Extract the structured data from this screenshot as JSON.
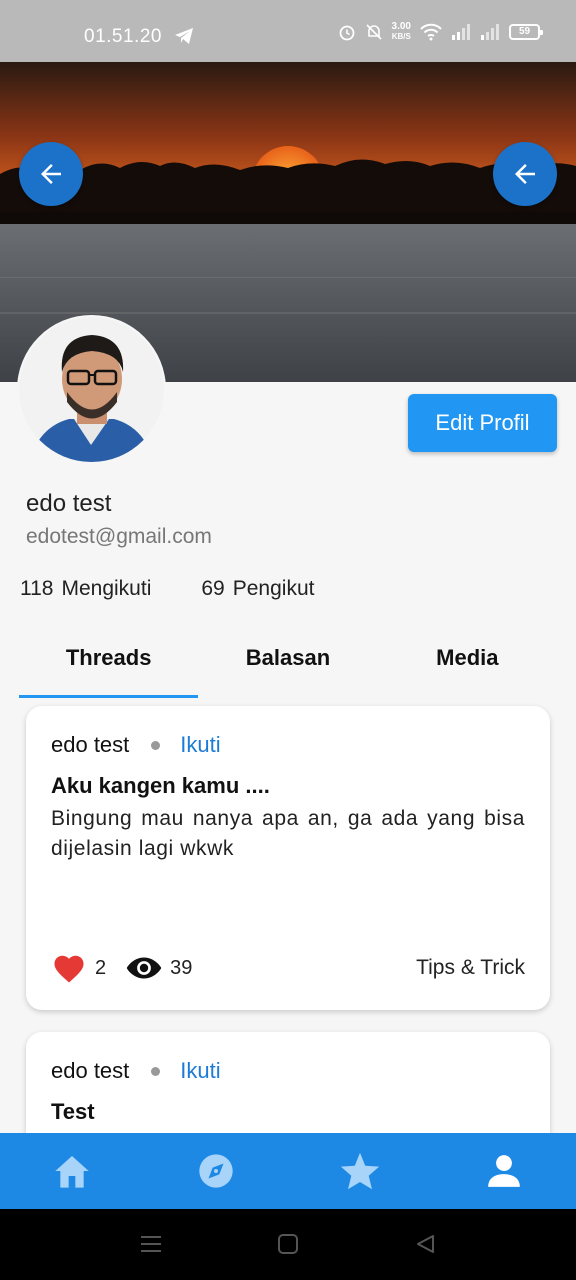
{
  "status_bar": {
    "time": "01.51.20",
    "speed_top": "3.00",
    "speed_unit": "KB/S",
    "battery": "59"
  },
  "profile": {
    "name": "edo test",
    "email": "edotest@gmail.com",
    "following_count": "118",
    "following_label": "Mengikuti",
    "followers_count": "69",
    "followers_label": "Pengikut",
    "edit_label": "Edit Profil"
  },
  "tabs": [
    {
      "label": "Threads",
      "active": true
    },
    {
      "label": "Balasan",
      "active": false
    },
    {
      "label": "Media",
      "active": false
    }
  ],
  "threads": [
    {
      "author": "edo test",
      "follow_label": "Ikuti",
      "title": "Aku kangen kamu ....",
      "body": "Bingung mau nanya apa an, ga ada yang bisa dijelasin lagi wkwk",
      "likes": "2",
      "views": "39",
      "category": "Tips & Trick"
    },
    {
      "author": "edo test",
      "follow_label": "Ikuti",
      "title": "Test"
    }
  ],
  "colors": {
    "primary": "#2196f3",
    "nav_bar": "#1e88e5",
    "back_button": "#1b72c8",
    "follow_link": "#1d7bd8",
    "like": "#e53935"
  },
  "icons": {
    "back_left": "arrow-left-icon",
    "back_right": "arrow-left-icon",
    "nav": [
      "home-icon",
      "compass-icon",
      "star-icon",
      "person-icon"
    ]
  }
}
